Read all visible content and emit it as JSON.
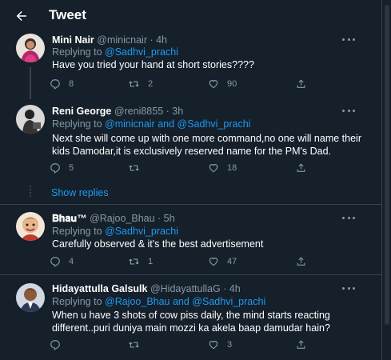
{
  "header": {
    "title": "Tweet"
  },
  "tweets": [
    {
      "name": "Mini Nair",
      "handle": "@minicnair · 4h",
      "replying_label": "Replying to ",
      "replying_to": "@Sadhvi_prachi",
      "text": "Have you tried your hand at short stories????",
      "replies": "8",
      "retweets": "2",
      "likes": "90"
    },
    {
      "name": "Reni George",
      "handle": "@reni8855 · 3h",
      "replying_label": "Replying to ",
      "replying_to": "@minicnair and @Sadhvi_prachi",
      "text": "Next she will come up with one more command,no one will name their kids Damodar,it is exclusively reserved name for the PM's Dad.",
      "replies": "5",
      "retweets": "",
      "likes": "18"
    },
    {
      "name": "𝐁𝐡𝐚𝐮™",
      "handle": "@Rajoo_Bhau · 5h",
      "replying_label": "Replying to ",
      "replying_to": "@Sadhvi_prachi",
      "text": "Carefully observed & it's the best advertisement",
      "replies": "4",
      "retweets": "1",
      "likes": "47"
    },
    {
      "name": "Hidayattulla Galsulk",
      "handle": "@HidayattullaG · 4h",
      "replying_label": "Replying to ",
      "replying_to": "@Rajoo_Bhau and @Sadhvi_prachi",
      "text": "When u have 3 shots of cow piss daily, the mind starts reacting different..puri duniya main mozzi ka akela baap damudar hain?",
      "replies": "",
      "retweets": "",
      "likes": "3"
    }
  ],
  "show_replies": "Show replies",
  "colors": {
    "background": "#15202b",
    "accent": "#1d9bf0",
    "secondary_text": "#8899a6",
    "border": "#38444d"
  }
}
